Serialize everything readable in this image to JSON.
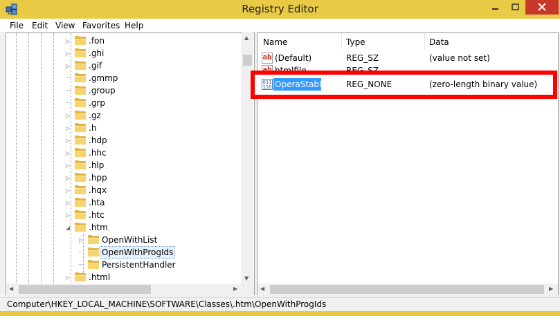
{
  "window": {
    "title": "Registry Editor"
  },
  "menu": [
    "File",
    "Edit",
    "View",
    "Favorites",
    "Help"
  ],
  "tree": {
    "items": [
      {
        "label": ".fon",
        "expander": "collapsed"
      },
      {
        "label": ".ghi",
        "expander": "collapsed"
      },
      {
        "label": ".gif",
        "expander": "collapsed"
      },
      {
        "label": ".gmmp",
        "expander": "none"
      },
      {
        "label": ".group",
        "expander": "none"
      },
      {
        "label": ".grp",
        "expander": "none"
      },
      {
        "label": ".gz",
        "expander": "collapsed"
      },
      {
        "label": ".h",
        "expander": "collapsed"
      },
      {
        "label": ".hdp",
        "expander": "collapsed"
      },
      {
        "label": ".hhc",
        "expander": "collapsed"
      },
      {
        "label": ".hlp",
        "expander": "collapsed"
      },
      {
        "label": ".hpp",
        "expander": "collapsed"
      },
      {
        "label": ".hqx",
        "expander": "collapsed"
      },
      {
        "label": ".hta",
        "expander": "collapsed"
      },
      {
        "label": ".htc",
        "expander": "collapsed"
      },
      {
        "label": ".htm",
        "expander": "expanded"
      },
      {
        "label": "OpenWithList",
        "expander": "collapsed",
        "child": true
      },
      {
        "label": "OpenWithProgIds",
        "expander": "none",
        "child": true,
        "selected": true
      },
      {
        "label": "PersistentHandler",
        "expander": "none",
        "child": true
      },
      {
        "label": ".html",
        "expander": "collapsed"
      }
    ]
  },
  "list": {
    "columns": [
      "Name",
      "Type",
      "Data"
    ],
    "rows": [
      {
        "name": "(Default)",
        "type": "REG_SZ",
        "data": "(value not set)",
        "icon": "string-value-icon"
      },
      {
        "name": "htmlfile",
        "type": "REG_SZ",
        "data": "",
        "icon": "string-value-icon"
      },
      {
        "name": "OperaStable",
        "type": "REG_NONE",
        "data": "(zero-length binary value)",
        "icon": "binary-value-icon",
        "selected": true
      }
    ]
  },
  "status": {
    "path": "Computer\\HKEY_LOCAL_MACHINE\\SOFTWARE\\Classes\\.htm\\OpenWithProgIds"
  },
  "colors": {
    "titlebar": "#e9ca45",
    "close": "#c7372a",
    "selection": "#3399ff",
    "highlight_box": "#ff0000"
  }
}
